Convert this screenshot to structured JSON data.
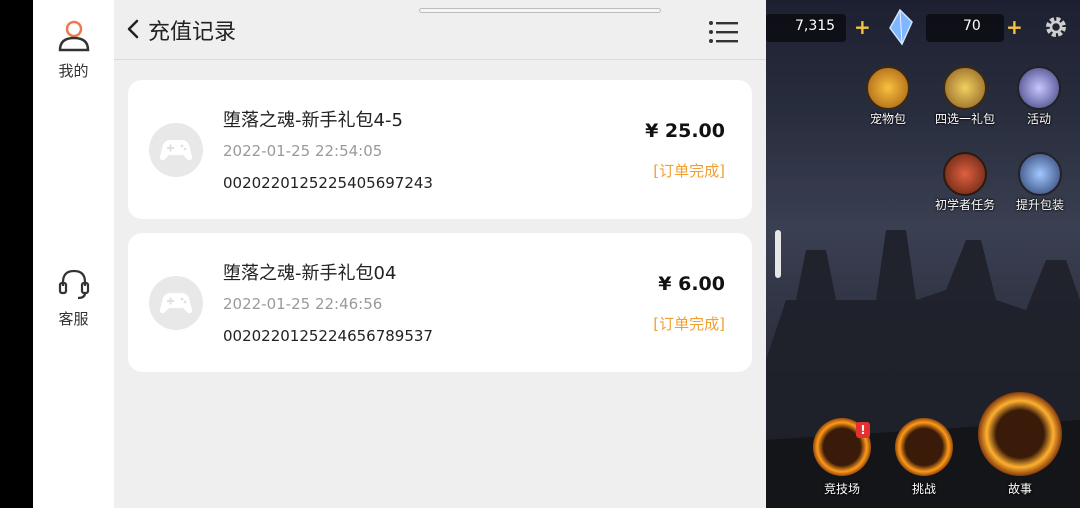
{
  "sidebar": {
    "items": [
      {
        "label": "我的",
        "icon": "user-icon"
      },
      {
        "label": "客服",
        "icon": "headset-icon"
      }
    ]
  },
  "header": {
    "title": "充值记录"
  },
  "records": [
    {
      "name": "堕落之魂-新手礼包4-5",
      "date": "2022-01-25 22:54:05",
      "order_no": "002022012522540569724​3",
      "price": "¥ 25.00",
      "status": "[订单完成]"
    },
    {
      "name": "堕落之魂-新手礼包04",
      "date": "2022-01-25 22:46:56",
      "order_no": "002022012522465678953​7",
      "price": "¥ 6.00",
      "status": "[订单完成]"
    }
  ],
  "game": {
    "resource1": "7,315",
    "resource2": "70",
    "buttons": [
      {
        "label": "宠物包"
      },
      {
        "label": "四选一礼包"
      },
      {
        "label": "活动"
      },
      {
        "label": "初学者任务"
      },
      {
        "label": "提升包装"
      }
    ],
    "bottom": [
      {
        "label": "竞技场"
      },
      {
        "label": "挑战"
      },
      {
        "label": "故事"
      }
    ]
  },
  "colors": {
    "status": "#f0a030",
    "accent_gold": "#f5c542"
  }
}
